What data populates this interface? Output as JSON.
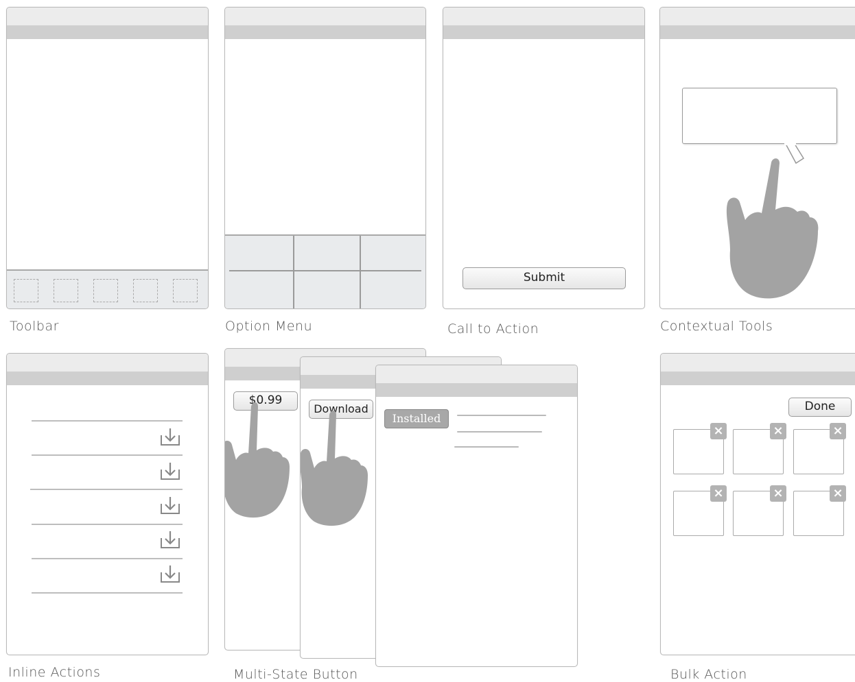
{
  "captions": {
    "toolbar": "Toolbar",
    "option_menu": "Option Menu",
    "call_to_action": "Call to Action",
    "contextual_tools": "Contextual Tools",
    "inline_actions": "Inline Actions",
    "multi_state_button": "Multi-State Button",
    "bulk_action": "Bulk Action"
  },
  "buttons": {
    "submit": "Submit",
    "price": "$0.99",
    "download": "Download",
    "installed": "Installed",
    "done": "Done"
  },
  "icons": {
    "download_row": "download-tray-icon",
    "remove_tile": "close-icon",
    "pointer": "pointing-hand-icon"
  },
  "colors": {
    "band": "#cfcfcf",
    "hand": "#a3a3a3",
    "strip": "#e9ebed"
  }
}
